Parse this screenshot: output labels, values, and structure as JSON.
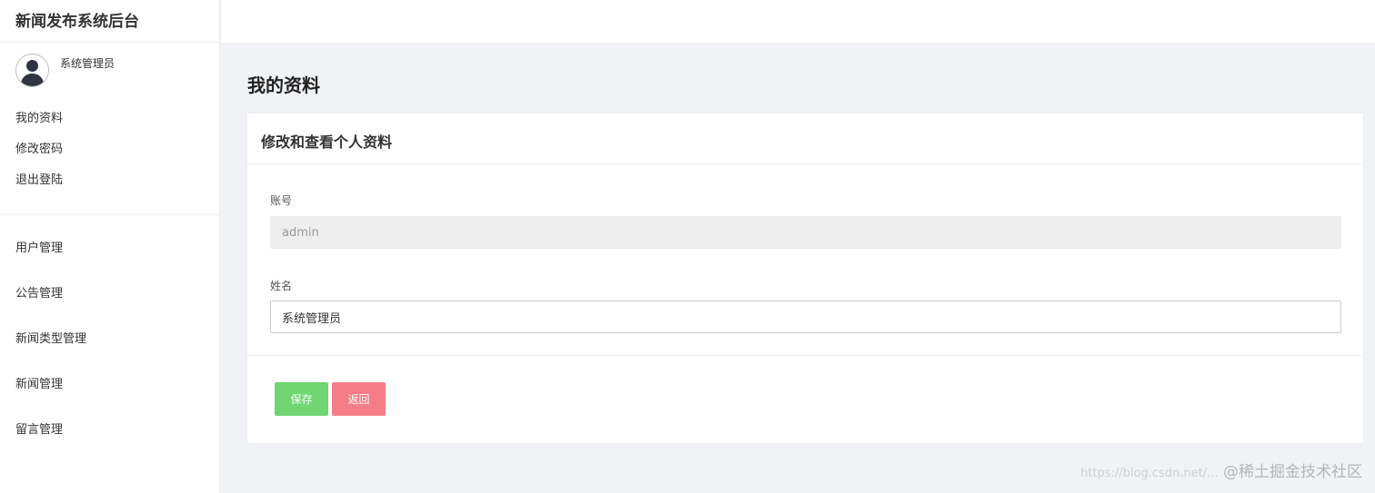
{
  "sidebar": {
    "brand": "新闻发布系统后台",
    "user": {
      "name": "系统管理员",
      "avatar_icon": "user-avatar-icon"
    },
    "account_items": [
      {
        "label": "我的资料"
      },
      {
        "label": "修改密码"
      },
      {
        "label": "退出登陆"
      }
    ],
    "menu_items": [
      {
        "label": "用户管理"
      },
      {
        "label": "公告管理"
      },
      {
        "label": "新闻类型管理"
      },
      {
        "label": "新闻管理"
      },
      {
        "label": "留言管理"
      }
    ]
  },
  "main": {
    "page_title": "我的资料",
    "card": {
      "title": "修改和查看个人资料",
      "fields": [
        {
          "label": "账号",
          "value": "admin",
          "disabled": true
        },
        {
          "label": "姓名",
          "value": "系统管理员",
          "disabled": false
        }
      ],
      "buttons": {
        "save": "保存",
        "back": "返回"
      }
    }
  },
  "watermark": {
    "url": "https://blog.csdn.net/...",
    "text": "@稀土掘金技术社区"
  },
  "colors": {
    "save_button": "#6fd672",
    "back_button": "#f67d88",
    "page_background": "#f0f2f5"
  }
}
